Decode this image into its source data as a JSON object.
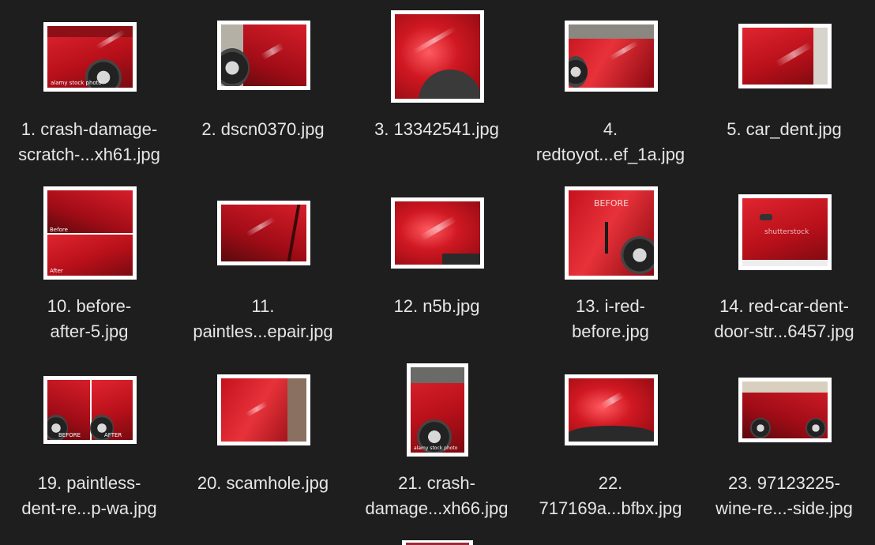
{
  "files": [
    {
      "label": "1. crash-damage-\nscratch-...xh61.jpg",
      "overlay": "alamy stock photo"
    },
    {
      "label": "2. dscn0370.jpg"
    },
    {
      "label": "3. 13342541.jpg"
    },
    {
      "label": "4.\nredtoyot...ef_1a.jpg"
    },
    {
      "label": "5. car_dent.jpg"
    },
    {
      "label": "10. before-\nafter-5.jpg",
      "overlay_top": "Before",
      "overlay_bottom": "After"
    },
    {
      "label": "11.\npaintles...epair.jpg"
    },
    {
      "label": "12. n5b.jpg"
    },
    {
      "label": "13. i-red-\nbefore.jpg",
      "overlay": "BEFORE"
    },
    {
      "label": "14. red-car-dent-\ndoor-str...6457.jpg",
      "overlay": "shutterstock"
    },
    {
      "label": "19. paintless-\ndent-re...p-wa.jpg",
      "overlay_left": "BEFORE",
      "overlay_right": "AFTER"
    },
    {
      "label": "20. scamhole.jpg"
    },
    {
      "label": "21. crash-\ndamage...xh66.jpg",
      "overlay": "alamy stock photo"
    },
    {
      "label": "22.\n717169a...bfbx.jpg"
    },
    {
      "label": "23. 97123225-\nwine-re...-side.jpg"
    }
  ]
}
